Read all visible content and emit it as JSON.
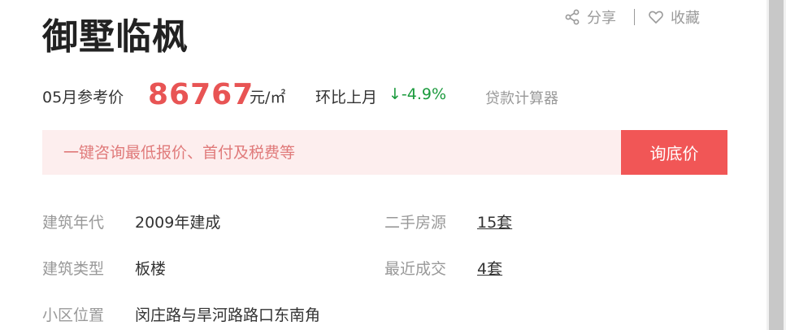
{
  "title": "御墅临枫",
  "actions": {
    "share": "分享",
    "favorite": "收藏"
  },
  "price": {
    "label": "05月参考价",
    "value": "86767",
    "unit": "元/㎡",
    "mom_label": "环比上月",
    "mom_value": "↓-4.9%",
    "loan_calculator": "贷款计算器"
  },
  "consult": {
    "placeholder": "一键咨询最低报价、首付及税费等",
    "button": "询底价"
  },
  "info": {
    "build_year": {
      "label": "建筑年代",
      "value": "2009年建成"
    },
    "second_hand": {
      "label": "二手房源",
      "value": "15套"
    },
    "build_type": {
      "label": "建筑类型",
      "value": "板楼"
    },
    "recent_deals": {
      "label": "最近成交",
      "value": "4套"
    },
    "location": {
      "label": "小区位置",
      "value": "闵庄路与旱河路路口东南角"
    }
  },
  "colors": {
    "price": "#e85454",
    "mom": "#1a9a3c",
    "button": "#f15656",
    "consult_bg": "#fdeeee"
  },
  "icons": {
    "share": "share-icon",
    "favorite": "heart-icon"
  }
}
